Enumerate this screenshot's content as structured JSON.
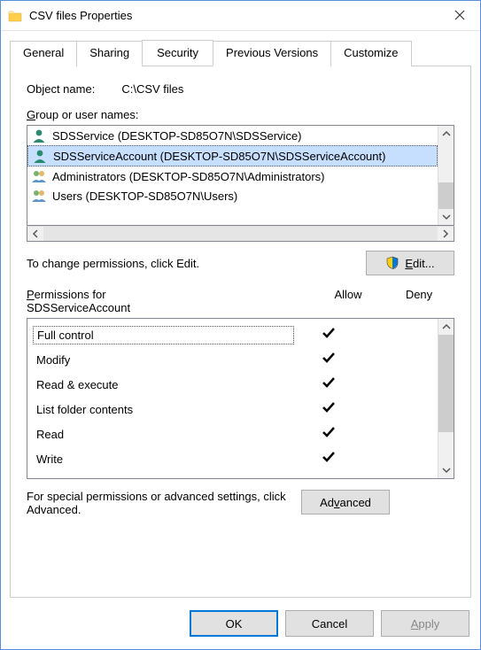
{
  "window": {
    "title": "CSV files Properties"
  },
  "tabs": {
    "general": "General",
    "sharing": "Sharing",
    "security": "Security",
    "previous": "Previous Versions",
    "customize": "Customize"
  },
  "object": {
    "label": "Object name:",
    "value": "C:\\CSV files"
  },
  "group": {
    "label_pre": "G",
    "label_post": "roup or user names:",
    "items": [
      {
        "icon": "single",
        "text": "SDSService (DESKTOP-SD85O7N\\SDSService)",
        "selected": false
      },
      {
        "icon": "single",
        "text": "SDSServiceAccount (DESKTOP-SD85O7N\\SDSServiceAccount)",
        "selected": true
      },
      {
        "icon": "multi",
        "text": "Administrators (DESKTOP-SD85O7N\\Administrators)",
        "selected": false
      },
      {
        "icon": "multi",
        "text": "Users (DESKTOP-SD85O7N\\Users)",
        "selected": false
      }
    ]
  },
  "edit": {
    "note": "To change permissions, click Edit.",
    "button_pre": "E",
    "button_post": "dit..."
  },
  "perm": {
    "label_pre": "P",
    "label_mid": "ermissions for",
    "subject": "SDSServiceAccount",
    "allow": "Allow",
    "deny": "Deny",
    "rows": [
      {
        "name": "Full control",
        "allow": true,
        "deny": false
      },
      {
        "name": "Modify",
        "allow": true,
        "deny": false
      },
      {
        "name": "Read & execute",
        "allow": true,
        "deny": false
      },
      {
        "name": "List folder contents",
        "allow": true,
        "deny": false
      },
      {
        "name": "Read",
        "allow": true,
        "deny": false
      },
      {
        "name": "Write",
        "allow": true,
        "deny": false
      }
    ]
  },
  "special": {
    "text": "For special permissions or advanced settings, click Advanced.",
    "button_pre": "Ad",
    "button_u": "v",
    "button_post": "anced"
  },
  "footer": {
    "ok": "OK",
    "cancel": "Cancel",
    "apply_pre": "A",
    "apply_post": "pply"
  }
}
